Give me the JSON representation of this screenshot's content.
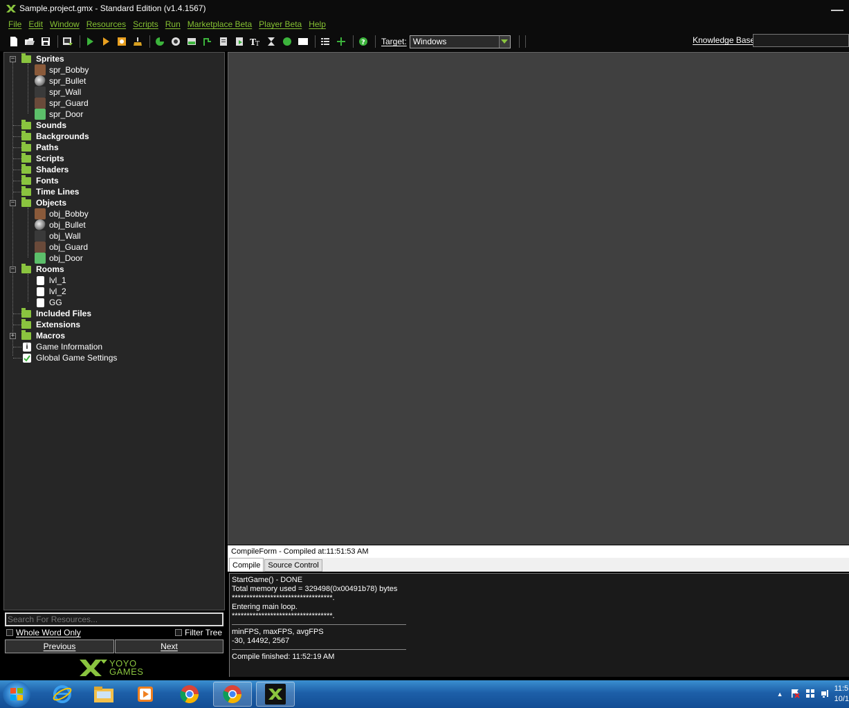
{
  "window": {
    "title": "Sample.project.gmx  -  Standard Edition (v1.4.1567)"
  },
  "menu": [
    "File",
    "Edit",
    "Window",
    "Resources",
    "Scripts",
    "Run",
    "Marketplace Beta",
    "Player Beta",
    "Help"
  ],
  "toolbar": {
    "target_label": "Target:",
    "target_value": "Windows",
    "kb_label": "Knowledge Base:",
    "kb_value": ""
  },
  "tree": {
    "sprites": {
      "label": "Sprites",
      "items": [
        "spr_Bobby",
        "spr_Bullet",
        "spr_Wall",
        "spr_Guard",
        "spr_Door"
      ]
    },
    "sounds": "Sounds",
    "backgrounds": "Backgrounds",
    "paths": "Paths",
    "scripts": "Scripts",
    "shaders": "Shaders",
    "fonts": "Fonts",
    "timelines": "Time Lines",
    "objects": {
      "label": "Objects",
      "items": [
        "obj_Bobby",
        "obj_Bullet",
        "obj_Wall",
        "obj_Guard",
        "obj_Door"
      ]
    },
    "rooms": {
      "label": "Rooms",
      "items": [
        "lvl_1",
        "lvl_2",
        "GG"
      ]
    },
    "included_files": "Included Files",
    "extensions": "Extensions",
    "macros": "Macros",
    "game_information": "Game Information",
    "global_game_settings": "Global Game Settings"
  },
  "search": {
    "placeholder": "Search For Resources...",
    "whole_word": "Whole Word Only",
    "filter_tree": "Filter Tree",
    "previous": "Previous",
    "next": "Next"
  },
  "logo": {
    "line1": "YOYO",
    "line2": "GAMES"
  },
  "compile": {
    "header": "CompileForm - Compiled at:11:51:53 AM",
    "tabs": [
      "Compile",
      "Source Control"
    ],
    "lines_a": [
      "StartGame() - DONE",
      "Total memory used = 329498(0x00491b78) bytes",
      "**********************************.",
      "Entering main loop.",
      "**********************************."
    ],
    "lines_b": [
      "minFPS, maxFPS, avgFPS",
      "-30, 14492, 2567"
    ],
    "finished": "Compile finished: 11:52:19 AM"
  },
  "taskbar": {
    "clock_time": "11:5",
    "clock_date": "10/1"
  }
}
